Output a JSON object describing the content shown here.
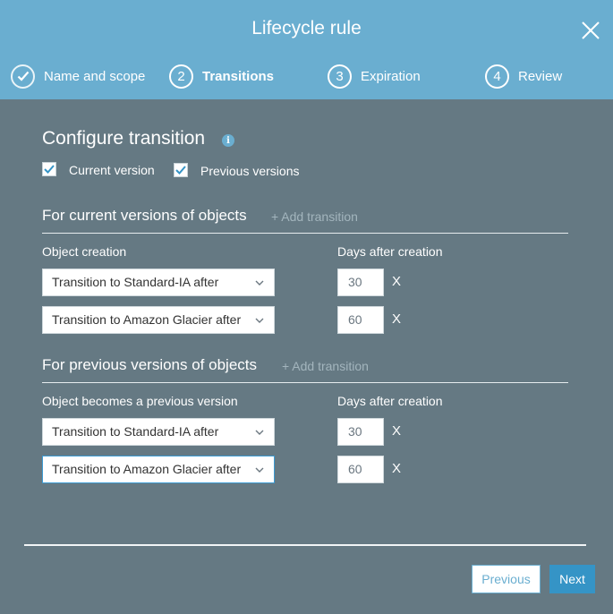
{
  "dialog": {
    "title": "Lifecycle rule"
  },
  "steps": [
    {
      "number": "",
      "label": "Name and scope",
      "state": "complete"
    },
    {
      "number": "2",
      "label": "Transitions",
      "state": "active"
    },
    {
      "number": "3",
      "label": "Expiration",
      "state": "pending"
    },
    {
      "number": "4",
      "label": "Review",
      "state": "pending"
    }
  ],
  "configure": {
    "title": "Configure transition",
    "current_version_label": "Current version",
    "current_version_checked": true,
    "previous_versions_label": "Previous versions",
    "previous_versions_checked": true
  },
  "current_group": {
    "title": "For current versions of objects",
    "add_link": "+ Add transition",
    "left_header": "Object creation",
    "right_header": "Days after creation",
    "rows": [
      {
        "transition": "Transition to Standard-IA after",
        "days": "30",
        "remove": "X"
      },
      {
        "transition": "Transition to Amazon Glacier after",
        "days": "60",
        "remove": "X"
      }
    ]
  },
  "previous_group": {
    "title": "For previous versions of objects",
    "add_link": "+ Add transition",
    "left_header": "Object becomes a previous version",
    "right_header": "Days after creation",
    "rows": [
      {
        "transition": "Transition to Standard-IA after",
        "days": "30",
        "remove": "X"
      },
      {
        "transition": "Transition to Amazon Glacier after",
        "days": "60",
        "remove": "X"
      }
    ]
  },
  "footer": {
    "previous_label": "Previous",
    "next_label": "Next"
  },
  "colors": {
    "header": "#6aaed0",
    "body": "#657983",
    "primary_button": "#3594c6",
    "focus": "#3d9bd3"
  }
}
